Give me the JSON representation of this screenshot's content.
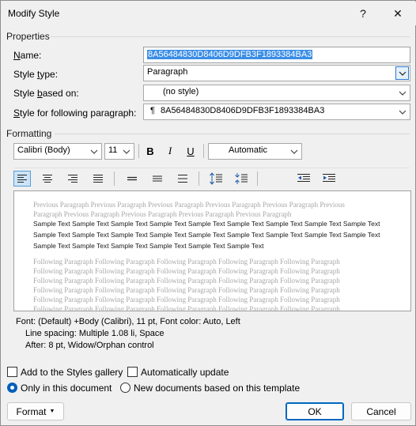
{
  "window": {
    "title": "Modify Style",
    "help_label": "?",
    "close_label": "✕"
  },
  "properties": {
    "section_label": "Properties",
    "name_label": "Name:",
    "name_value": "8A56484830D8406D9DFB3F1893384BA3",
    "type_label": "Style type:",
    "type_value": "Paragraph",
    "based_on_label": "Style based on:",
    "based_on_value": "(no style)",
    "following_label": "Style for following paragraph:",
    "following_value": "8A56484830D8406D9DFB3F1893384BA3",
    "following_mark": "¶"
  },
  "formatting": {
    "section_label": "Formatting",
    "font_value": "Calibri (Body)",
    "size_value": "11",
    "bold": "B",
    "italic": "I",
    "underline": "U",
    "color_value": "Automatic"
  },
  "preview": {
    "previous_text": "Previous Paragraph Previous Paragraph Previous Paragraph Previous Paragraph Previous Paragraph Previous Paragraph Previous Paragraph Previous Paragraph Previous Paragraph Previous Paragraph",
    "sample_lines": [
      "Sample Text Sample Text Sample Text Sample Text Sample Text Sample Text Sample Text Sample Text Sample Text",
      "Sample Text Sample Text Sample Text Sample Text Sample Text Sample Text Sample Text Sample Text Sample Text",
      "Sample Text Sample Text Sample Text Sample Text Sample Text Sample Text"
    ],
    "following_lines": [
      "Following Paragraph Following Paragraph Following Paragraph Following Paragraph Following Paragraph",
      "Following Paragraph Following Paragraph Following Paragraph Following Paragraph Following Paragraph",
      "Following Paragraph Following Paragraph Following Paragraph Following Paragraph Following Paragraph",
      "Following Paragraph Following Paragraph Following Paragraph Following Paragraph Following Paragraph",
      "Following Paragraph Following Paragraph Following Paragraph Following Paragraph Following Paragraph",
      "Following Paragraph Following Paragraph Following Paragraph Following Paragraph Following Paragraph"
    ]
  },
  "description": {
    "line1": "Font: (Default) +Body (Calibri), 11 pt, Font color: Auto, Left",
    "line2": "Line spacing:  Multiple 1.08 li, Space",
    "line3": "After:  8 pt, Widow/Orphan control"
  },
  "options": {
    "add_gallery": "Add to the Styles gallery",
    "auto_update": "Automatically update",
    "only_doc": "Only in this document",
    "new_docs": "New documents based on this template"
  },
  "buttons": {
    "format": "Format",
    "ok": "OK",
    "cancel": "Cancel"
  },
  "colors": {
    "accent": "#0067c0",
    "selection": "#3b8ee6"
  }
}
